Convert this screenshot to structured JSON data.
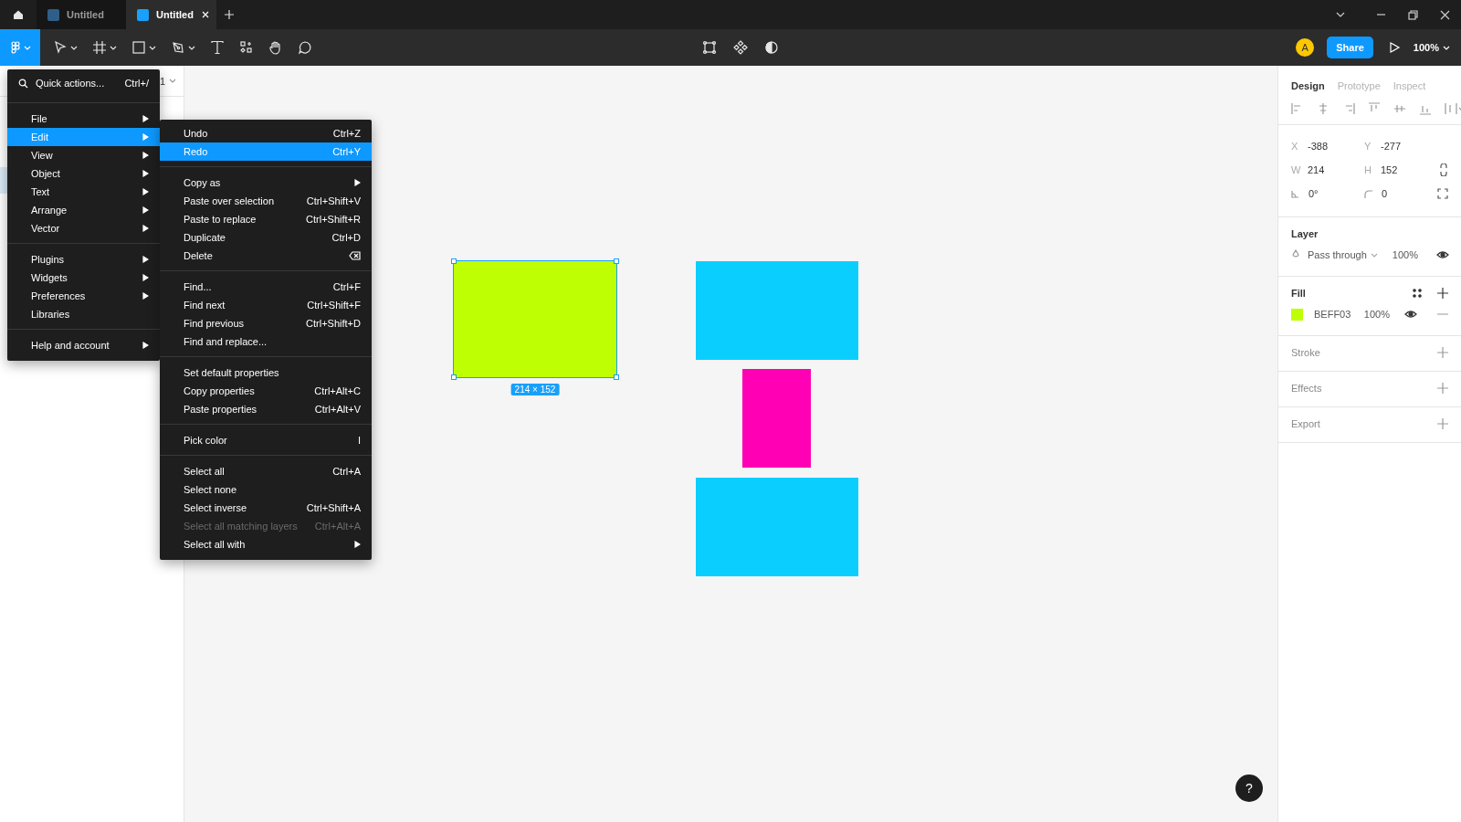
{
  "tabs": [
    {
      "label": "Untitled",
      "selected": false
    },
    {
      "label": "Untitled",
      "selected": true
    }
  ],
  "toolbar": {
    "avatar": "A",
    "share": "Share",
    "zoom": "100%"
  },
  "left_panel": {
    "page_label": "1"
  },
  "main_menu": {
    "quick_actions": {
      "label": "Quick actions...",
      "shortcut": "Ctrl+/"
    },
    "groups": [
      [
        {
          "label": "File",
          "kind": "submenu",
          "selected": false
        },
        {
          "label": "Edit",
          "kind": "submenu",
          "selected": true
        },
        {
          "label": "View",
          "kind": "submenu",
          "selected": false
        },
        {
          "label": "Object",
          "kind": "submenu",
          "selected": false
        },
        {
          "label": "Text",
          "kind": "submenu",
          "selected": false
        },
        {
          "label": "Arrange",
          "kind": "submenu",
          "selected": false
        },
        {
          "label": "Vector",
          "kind": "submenu",
          "selected": false
        }
      ],
      [
        {
          "label": "Plugins",
          "kind": "submenu",
          "selected": false
        },
        {
          "label": "Widgets",
          "kind": "submenu",
          "selected": false
        },
        {
          "label": "Preferences",
          "kind": "submenu",
          "selected": false
        },
        {
          "label": "Libraries",
          "kind": "plain",
          "selected": false
        }
      ],
      [
        {
          "label": "Help and account",
          "kind": "submenu",
          "selected": false
        }
      ]
    ]
  },
  "edit_menu": {
    "groups": [
      [
        {
          "label": "Undo",
          "kind": "shortcut",
          "shortcut": "Ctrl+Z",
          "selected": false,
          "disabled": false
        },
        {
          "label": "Redo",
          "kind": "shortcut",
          "shortcut": "Ctrl+Y",
          "selected": true,
          "disabled": false
        }
      ],
      [
        {
          "label": "Copy as",
          "kind": "submenu",
          "selected": false,
          "disabled": false
        },
        {
          "label": "Paste over selection",
          "kind": "shortcut",
          "shortcut": "Ctrl+Shift+V",
          "selected": false,
          "disabled": false
        },
        {
          "label": "Paste to replace",
          "kind": "shortcut",
          "shortcut": "Ctrl+Shift+R",
          "selected": false,
          "disabled": false
        },
        {
          "label": "Duplicate",
          "kind": "shortcut",
          "shortcut": "Ctrl+D",
          "selected": false,
          "disabled": false
        },
        {
          "label": "Delete",
          "kind": "backspace",
          "selected": false,
          "disabled": false
        }
      ],
      [
        {
          "label": "Find...",
          "kind": "shortcut",
          "shortcut": "Ctrl+F",
          "selected": false,
          "disabled": false
        },
        {
          "label": "Find next",
          "kind": "shortcut",
          "shortcut": "Ctrl+Shift+F",
          "selected": false,
          "disabled": false
        },
        {
          "label": "Find previous",
          "kind": "shortcut",
          "shortcut": "Ctrl+Shift+D",
          "selected": false,
          "disabled": false
        },
        {
          "label": "Find and replace...",
          "kind": "plain",
          "selected": false,
          "disabled": false
        }
      ],
      [
        {
          "label": "Set default properties",
          "kind": "plain",
          "selected": false,
          "disabled": false
        },
        {
          "label": "Copy properties",
          "kind": "shortcut",
          "shortcut": "Ctrl+Alt+C",
          "selected": false,
          "disabled": false
        },
        {
          "label": "Paste properties",
          "kind": "shortcut",
          "shortcut": "Ctrl+Alt+V",
          "selected": false,
          "disabled": false
        }
      ],
      [
        {
          "label": "Pick color",
          "kind": "shortcut",
          "shortcut": "I",
          "selected": false,
          "disabled": false
        }
      ],
      [
        {
          "label": "Select all",
          "kind": "shortcut",
          "shortcut": "Ctrl+A",
          "selected": false,
          "disabled": false
        },
        {
          "label": "Select none",
          "kind": "plain",
          "selected": false,
          "disabled": false
        },
        {
          "label": "Select inverse",
          "kind": "shortcut",
          "shortcut": "Ctrl+Shift+A",
          "selected": false,
          "disabled": false
        },
        {
          "label": "Select all matching layers",
          "kind": "shortcut",
          "shortcut": "Ctrl+Alt+A",
          "selected": false,
          "disabled": true
        },
        {
          "label": "Select all with",
          "kind": "submenu",
          "selected": false,
          "disabled": false
        }
      ]
    ]
  },
  "canvas": {
    "shapes": [
      {
        "color": "#beff03",
        "selected": true
      },
      {
        "color": "#0acffe",
        "selected": false
      },
      {
        "color": "#ff00b4",
        "selected": false
      },
      {
        "color": "#0acffe",
        "selected": false
      }
    ],
    "size_label": "214 × 152"
  },
  "design_panel": {
    "tabs": [
      {
        "label": "Design",
        "selected": true
      },
      {
        "label": "Prototype",
        "selected": false
      },
      {
        "label": "Inspect",
        "selected": false
      }
    ],
    "fields": [
      {
        "kind": "text",
        "label": "X",
        "value": "-388"
      },
      {
        "kind": "text",
        "label": "Y",
        "value": "-277"
      },
      {
        "kind": "text",
        "label": "W",
        "value": "214"
      },
      {
        "kind": "text",
        "label": "H",
        "value": "152"
      },
      {
        "kind": "rotation",
        "value": "0°"
      },
      {
        "kind": "radius",
        "value": "0"
      }
    ],
    "layer": {
      "title": "Layer",
      "blend": "Pass through",
      "opacity": "100%"
    },
    "fill": {
      "title": "Fill",
      "hex": "BEFF03",
      "opacity": "100%",
      "color": "#beff03"
    },
    "sections": [
      {
        "title": "Stroke"
      },
      {
        "title": "Effects"
      },
      {
        "title": "Export"
      }
    ]
  },
  "help": "?"
}
